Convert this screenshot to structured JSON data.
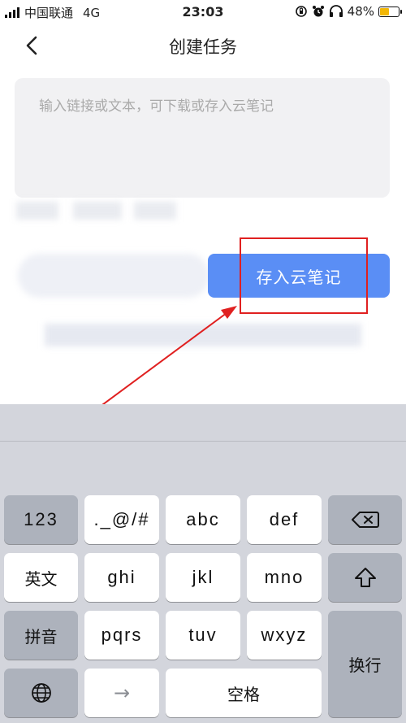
{
  "status_bar": {
    "carrier": "中国联通",
    "network": "4G",
    "time": "23:03",
    "battery": "48%",
    "battery_level": 0.48
  },
  "nav": {
    "title": "创建任务"
  },
  "input": {
    "placeholder": "输入链接或文本，可下载或存入云笔记"
  },
  "actions": {
    "save_label": "存入云笔记"
  },
  "keyboard": {
    "rows": [
      [
        "123",
        "._@/#",
        "abc",
        "def"
      ],
      [
        "英文",
        "ghi",
        "jkl",
        "mno"
      ],
      [
        "拼音",
        "pqrs",
        "tuv",
        "wxyz"
      ]
    ],
    "space": "空格",
    "enter": "换行",
    "next": "→"
  }
}
